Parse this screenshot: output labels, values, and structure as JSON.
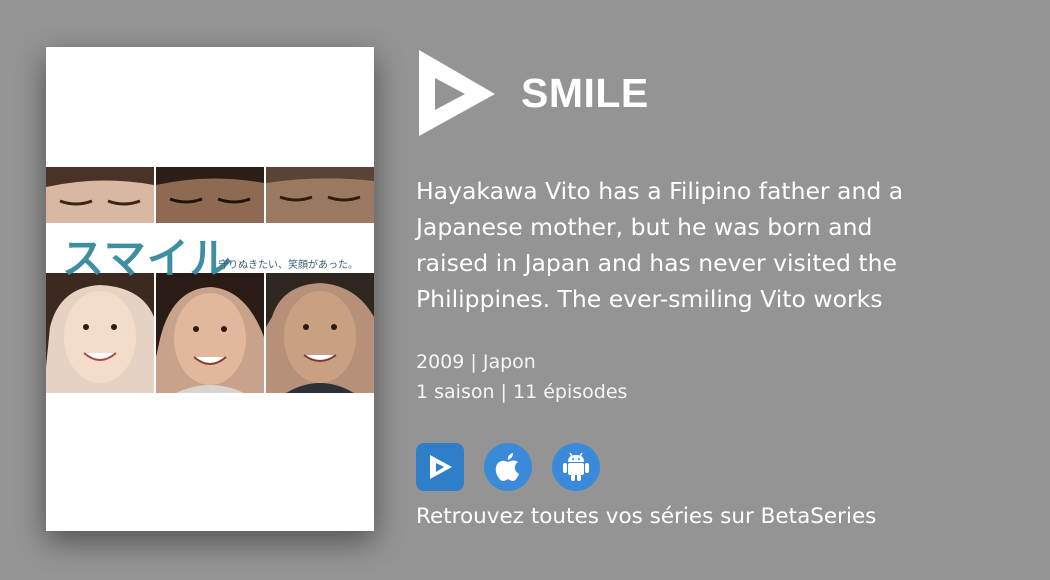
{
  "show": {
    "title": "SMILE",
    "synopsis_lines": [
      "Hayakawa Vito has a Filipino father and a",
      "Japanese mother, but he was born and",
      "raised in Japan and has never visited the",
      "Philippines. The ever-smiling Vito works"
    ],
    "year_country": "2009 | Japon",
    "seasons_episodes": "1 saison | 11 épisodes"
  },
  "poster": {
    "title_text": "スマイル",
    "tagline": "守りぬきたい、笑顔があった。"
  },
  "apps": [
    {
      "name": "betaseries",
      "icon": "betaseries-play-icon"
    },
    {
      "name": "ios",
      "icon": "apple-icon"
    },
    {
      "name": "android",
      "icon": "android-icon"
    }
  ],
  "cta": "Retrouvez toutes vos séries sur BetaSeries",
  "colors": {
    "background": "#949494",
    "app_button": "#3b8ad9",
    "poster_title": "#3d8ea0"
  }
}
